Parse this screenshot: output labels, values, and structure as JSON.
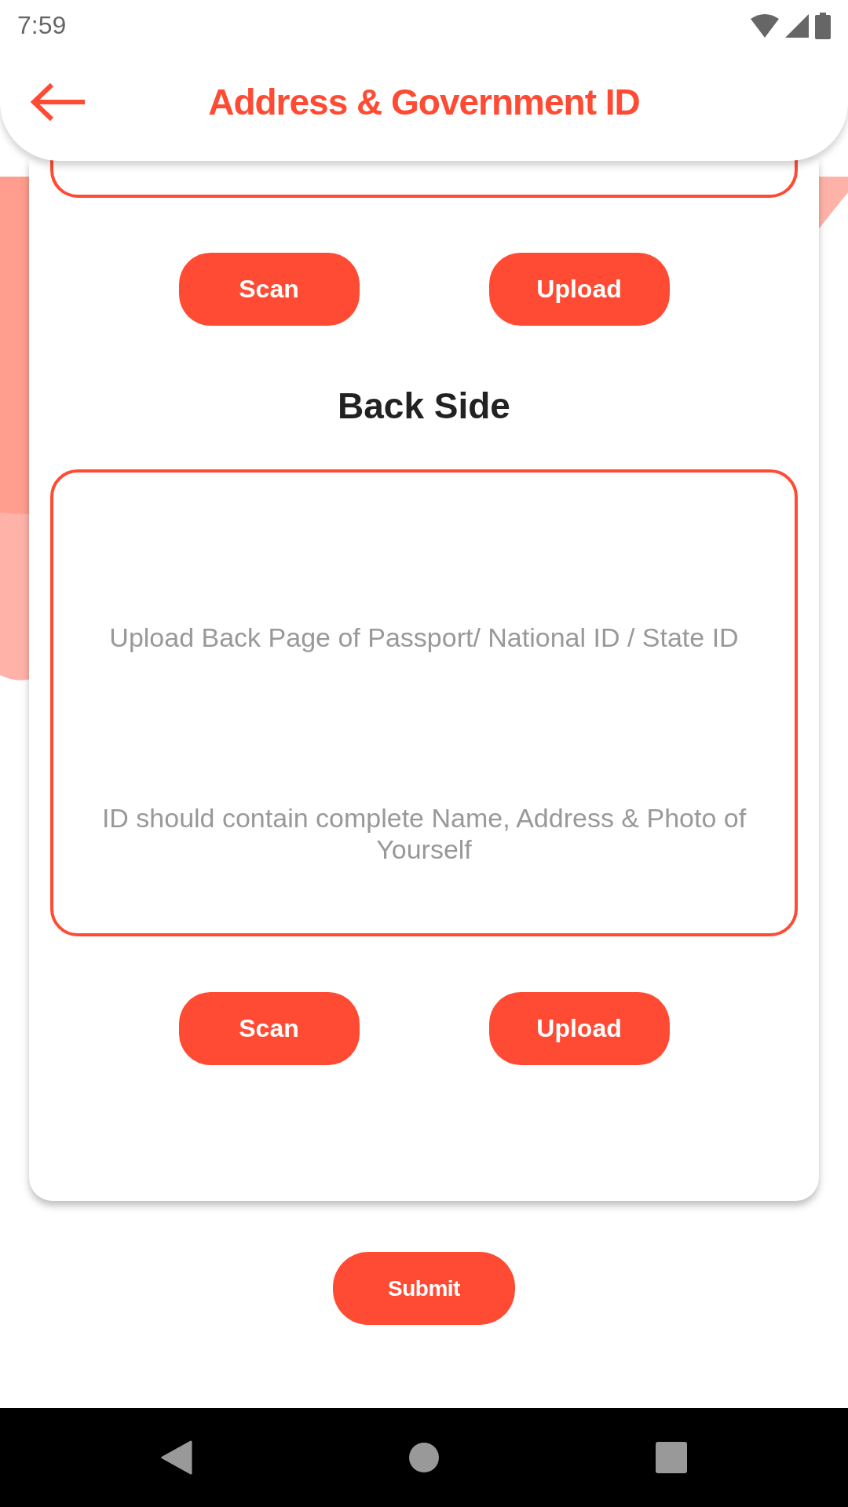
{
  "status_bar": {
    "time": "7:59"
  },
  "header": {
    "title": "Address & Government ID"
  },
  "sections": [
    {
      "buttons": [
        "Scan",
        "Upload"
      ]
    },
    {
      "title": "Back Side",
      "hint": "Upload Back Page of Passport/ National ID / State ID",
      "note": "ID should contain complete Name, Address & Photo of Yourself",
      "buttons": [
        "Scan",
        "Upload"
      ]
    }
  ],
  "submit": "Submit"
}
